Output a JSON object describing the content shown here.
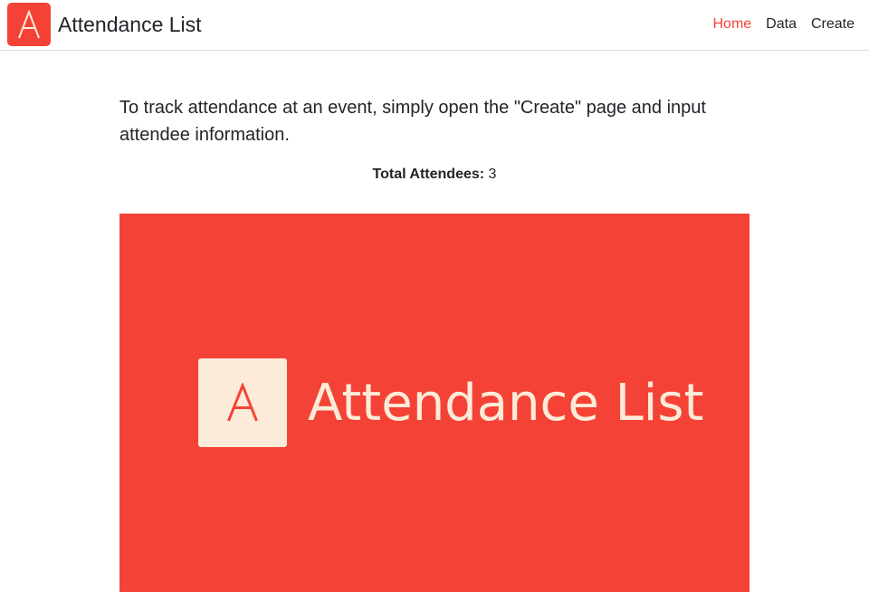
{
  "brand": {
    "letter": "A",
    "title": "Attendance List",
    "color": "#f44336"
  },
  "nav": {
    "items": [
      {
        "label": "Home",
        "active": true
      },
      {
        "label": "Data",
        "active": false
      },
      {
        "label": "Create",
        "active": false
      }
    ]
  },
  "main": {
    "intro": "To track attendance at an event, simply open the \"Create\" page and input attendee information.",
    "total_label": "Total Attendees:",
    "total_value": "3"
  },
  "hero": {
    "letter": "A",
    "title": "Attendance List",
    "background": "#f44336",
    "foreground": "#fdebd9"
  }
}
